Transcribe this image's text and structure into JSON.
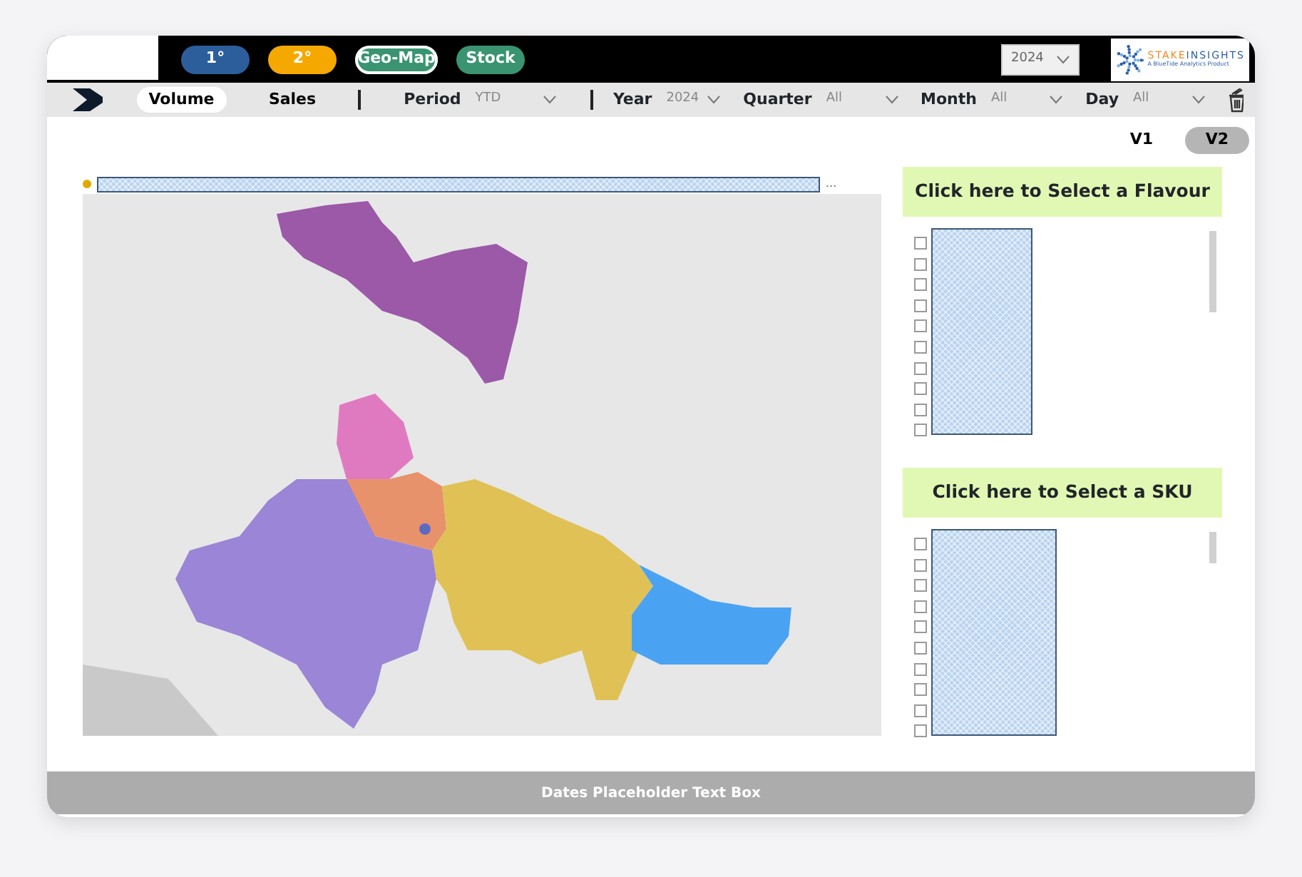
{
  "top_bar": {
    "nav_buttons": [
      {
        "label": "1°",
        "color": "#2c5e9c",
        "selected": false
      },
      {
        "label": "2°",
        "color": "#f5a800",
        "selected": false
      },
      {
        "label": "Geo-Map",
        "color": "#3a9471",
        "selected": true
      },
      {
        "label": "Stock",
        "color": "#3a9471",
        "selected": false
      }
    ],
    "year_dropdown": {
      "value": "2024"
    },
    "logo": {
      "name_part_1": "STAKE",
      "name_part_2": "INSIGHTS",
      "tagline": "A BlueTide Analytics Product"
    }
  },
  "filter_bar": {
    "measure_toggle": [
      {
        "label": "Volume",
        "selected": true
      },
      {
        "label": "Sales",
        "selected": false
      }
    ],
    "filters": [
      {
        "label": "Period",
        "value": "YTD",
        "divider_before": true
      },
      {
        "label": "Year",
        "value": "2024",
        "divider_before": true
      },
      {
        "label": "Quarter",
        "value": "All",
        "divider_before": false
      },
      {
        "label": "Month",
        "value": "All",
        "divider_before": false
      },
      {
        "label": "Day",
        "value": "All",
        "divider_before": false
      }
    ]
  },
  "version_toggle": [
    {
      "label": "V1",
      "selected": false
    },
    {
      "label": "V2",
      "selected": true
    }
  ],
  "map_panel": {
    "title_overflow": "..."
  },
  "slicers": [
    {
      "header": "Click here to Select a Flavour",
      "items": [
        {
          "checked": false
        },
        {
          "checked": false
        },
        {
          "checked": false
        },
        {
          "checked": false
        },
        {
          "checked": false
        },
        {
          "checked": false
        },
        {
          "checked": false
        },
        {
          "checked": false
        },
        {
          "checked": false
        },
        {
          "checked": false
        }
      ]
    },
    {
      "header": "Click here to Select a SKU",
      "items": [
        {
          "checked": false
        },
        {
          "checked": false
        },
        {
          "checked": false
        },
        {
          "checked": false
        },
        {
          "checked": false
        },
        {
          "checked": false
        },
        {
          "checked": false
        },
        {
          "checked": false
        },
        {
          "checked": false
        },
        {
          "checked": false
        }
      ]
    }
  ],
  "footer": {
    "text": "Dates Placeholder Text Box"
  }
}
